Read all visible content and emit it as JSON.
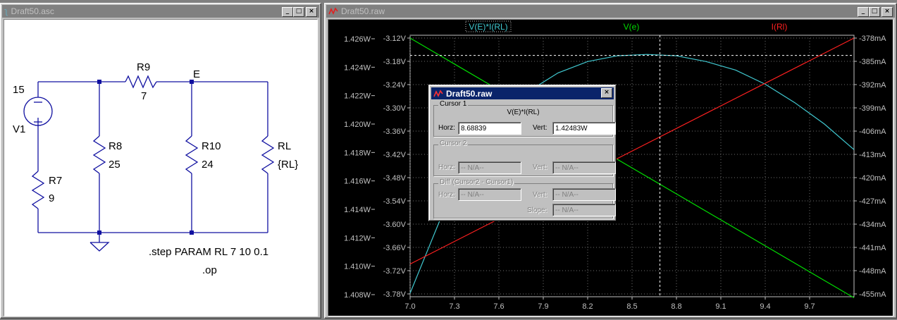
{
  "schematic_window": {
    "title": "Draft50.asc",
    "labels": {
      "v1_value": "15",
      "v1_name": "V1",
      "r9_name": "R9",
      "r9_value": "7",
      "node_e": "E",
      "r8_name": "R8",
      "r8_value": "25",
      "r10_name": "R10",
      "r10_value": "24",
      "rl_name": "RL",
      "rl_value": "{RL}",
      "r7_name": "R7",
      "r7_value": "9",
      "directive_step": ".step PARAM RL 7 10 0.1",
      "directive_op": ".op"
    }
  },
  "plot_window": {
    "title": "Draft50.raw",
    "traces": [
      {
        "label": "V(E)*I(RL)",
        "color": "#40c8d0"
      },
      {
        "label": "V(e)",
        "color": "#00dd00"
      },
      {
        "label": "I(Rl)",
        "color": "#ff2020"
      }
    ],
    "left_axis_ticks": [
      "1.426W",
      "1.424W",
      "1.422W",
      "1.420W",
      "1.418W",
      "1.416W",
      "1.414W",
      "1.412W",
      "1.410W",
      "1.408W"
    ],
    "mid_axis_ticks": [
      "-3.12V",
      "-3.18V",
      "-3.24V",
      "-3.30V",
      "-3.36V",
      "-3.42V",
      "-3.48V",
      "-3.54V",
      "-3.60V",
      "-3.66V",
      "-3.72V",
      "-3.78V"
    ],
    "right_axis_ticks": [
      "-378mA",
      "-385mA",
      "-392mA",
      "-399mA",
      "-406mA",
      "-413mA",
      "-420mA",
      "-427mA",
      "-434mA",
      "-441mA",
      "-448mA",
      "-455mA"
    ],
    "x_axis_ticks": [
      "7.0",
      "7.3",
      "7.6",
      "7.9",
      "8.2",
      "8.5",
      "8.8",
      "9.1",
      "9.4",
      "9.7"
    ]
  },
  "chart_data": {
    "type": "line",
    "x_range": [
      7.0,
      10.0
    ],
    "x_ticks": [
      7.0,
      7.3,
      7.6,
      7.9,
      8.2,
      8.5,
      8.8,
      9.1,
      9.4,
      9.7
    ],
    "left_axis": {
      "unit": "W",
      "range": [
        1.408,
        1.426
      ]
    },
    "mid_axis": {
      "unit": "V",
      "range": [
        -3.78,
        -3.12
      ]
    },
    "right_axis": {
      "unit": "mA",
      "range": [
        -455,
        -378
      ]
    },
    "grid": true,
    "cursor_x": 8.68839,
    "series": [
      {
        "name": "V(E)*I(RL)",
        "axis": "left",
        "x": [
          7.0,
          7.2,
          7.4,
          7.6,
          7.8,
          8.0,
          8.2,
          8.4,
          8.6,
          8.8,
          9.0,
          9.2,
          9.4,
          9.6,
          9.8,
          10.0
        ],
        "y": [
          1.4081,
          1.4132,
          1.4172,
          1.4202,
          1.4223,
          1.4236,
          1.4244,
          1.4248,
          1.4249,
          1.4248,
          1.4244,
          1.4238,
          1.4228,
          1.4215,
          1.42,
          1.4182
        ]
      },
      {
        "name": "V(e)",
        "axis": "mid",
        "x": [
          7.0,
          10.0
        ],
        "y": [
          -3.12,
          -3.79
        ]
      },
      {
        "name": "I(Rl)",
        "axis": "right",
        "x": [
          7.0,
          10.0
        ],
        "y": [
          -446,
          -378
        ]
      }
    ]
  },
  "cursor_dialog": {
    "title": "Draft50.raw",
    "cursor1": {
      "group_label": "Cursor 1",
      "trace": "V(E)*I(RL)",
      "horz_label": "Horz:",
      "horz_value": "8.68839",
      "vert_label": "Vert:",
      "vert_value": "1.42483W"
    },
    "cursor2": {
      "group_label": "Cursor 2",
      "horz_label": "Horz:",
      "horz_value": "-- N/A--",
      "vert_label": "Vert:",
      "vert_value": "-- N/A--"
    },
    "diff": {
      "group_label": "Diff (Cursor2 - Cursor1)",
      "horz_label": "Horz:",
      "horz_value": "-- N/A--",
      "vert_label": "Vert:",
      "vert_value": "-- N/A--",
      "slope_label": "Slope:",
      "slope_value": "-- N/A--"
    }
  }
}
